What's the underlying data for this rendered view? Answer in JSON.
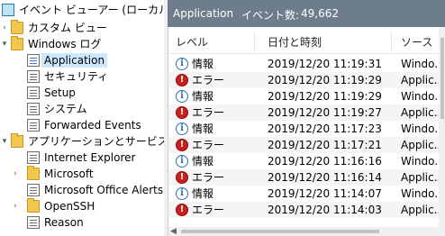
{
  "tree": {
    "items": [
      {
        "label": "イベント ビューアー (ローカル)",
        "icon": "computer-icon"
      },
      {
        "label": "カスタム ビュー",
        "icon": "folder-icon"
      },
      {
        "label": "Windows ログ",
        "icon": "folder-icon"
      },
      {
        "label": "Application",
        "icon": "log-icon",
        "selected": true
      },
      {
        "label": "セキュリティ",
        "icon": "log-icon"
      },
      {
        "label": "Setup",
        "icon": "log-icon"
      },
      {
        "label": "システム",
        "icon": "log-icon"
      },
      {
        "label": "Forwarded Events",
        "icon": "log-icon"
      },
      {
        "label": "アプリケーションとサービス ログ",
        "icon": "folder-icon"
      },
      {
        "label": "Internet Explorer",
        "icon": "log-icon"
      },
      {
        "label": "Microsoft",
        "icon": "folder-icon"
      },
      {
        "label": "Microsoft Office Alerts",
        "icon": "log-icon"
      },
      {
        "label": "OpenSSH",
        "icon": "folder-icon"
      },
      {
        "label": "Reason",
        "icon": "log-icon"
      }
    ]
  },
  "header": {
    "title": "Application",
    "count_label": "イベント数:",
    "count": "49,662"
  },
  "table": {
    "columns": [
      "レベル",
      "日付と時刻",
      "ソース"
    ],
    "rows": [
      {
        "level": "情報",
        "type": "info",
        "datetime": "2019/12/20 11:19:31",
        "source": "Windo..."
      },
      {
        "level": "エラー",
        "type": "error",
        "datetime": "2019/12/20 11:19:29",
        "source": "Applic..."
      },
      {
        "level": "情報",
        "type": "info",
        "datetime": "2019/12/20 11:19:29",
        "source": "Windo..."
      },
      {
        "level": "エラー",
        "type": "error",
        "datetime": "2019/12/20 11:19:27",
        "source": "Applic..."
      },
      {
        "level": "情報",
        "type": "info",
        "datetime": "2019/12/20 11:17:23",
        "source": "Windo..."
      },
      {
        "level": "エラー",
        "type": "error",
        "datetime": "2019/12/20 11:17:21",
        "source": "Applic..."
      },
      {
        "level": "情報",
        "type": "info",
        "datetime": "2019/12/20 11:16:16",
        "source": "Windo..."
      },
      {
        "level": "エラー",
        "type": "error",
        "datetime": "2019/12/20 11:16:14",
        "source": "Applic..."
      },
      {
        "level": "情報",
        "type": "info",
        "datetime": "2019/12/20 11:14:07",
        "source": "Windo..."
      },
      {
        "level": "エラー",
        "type": "error",
        "datetime": "2019/12/20 11:14:03",
        "source": "Applic..."
      }
    ]
  },
  "colors": {
    "header_bg": "#6d7d8c",
    "selected_bg": "#cce8ff",
    "error_red": "#c8201d",
    "info_blue": "#2f6fb3"
  }
}
